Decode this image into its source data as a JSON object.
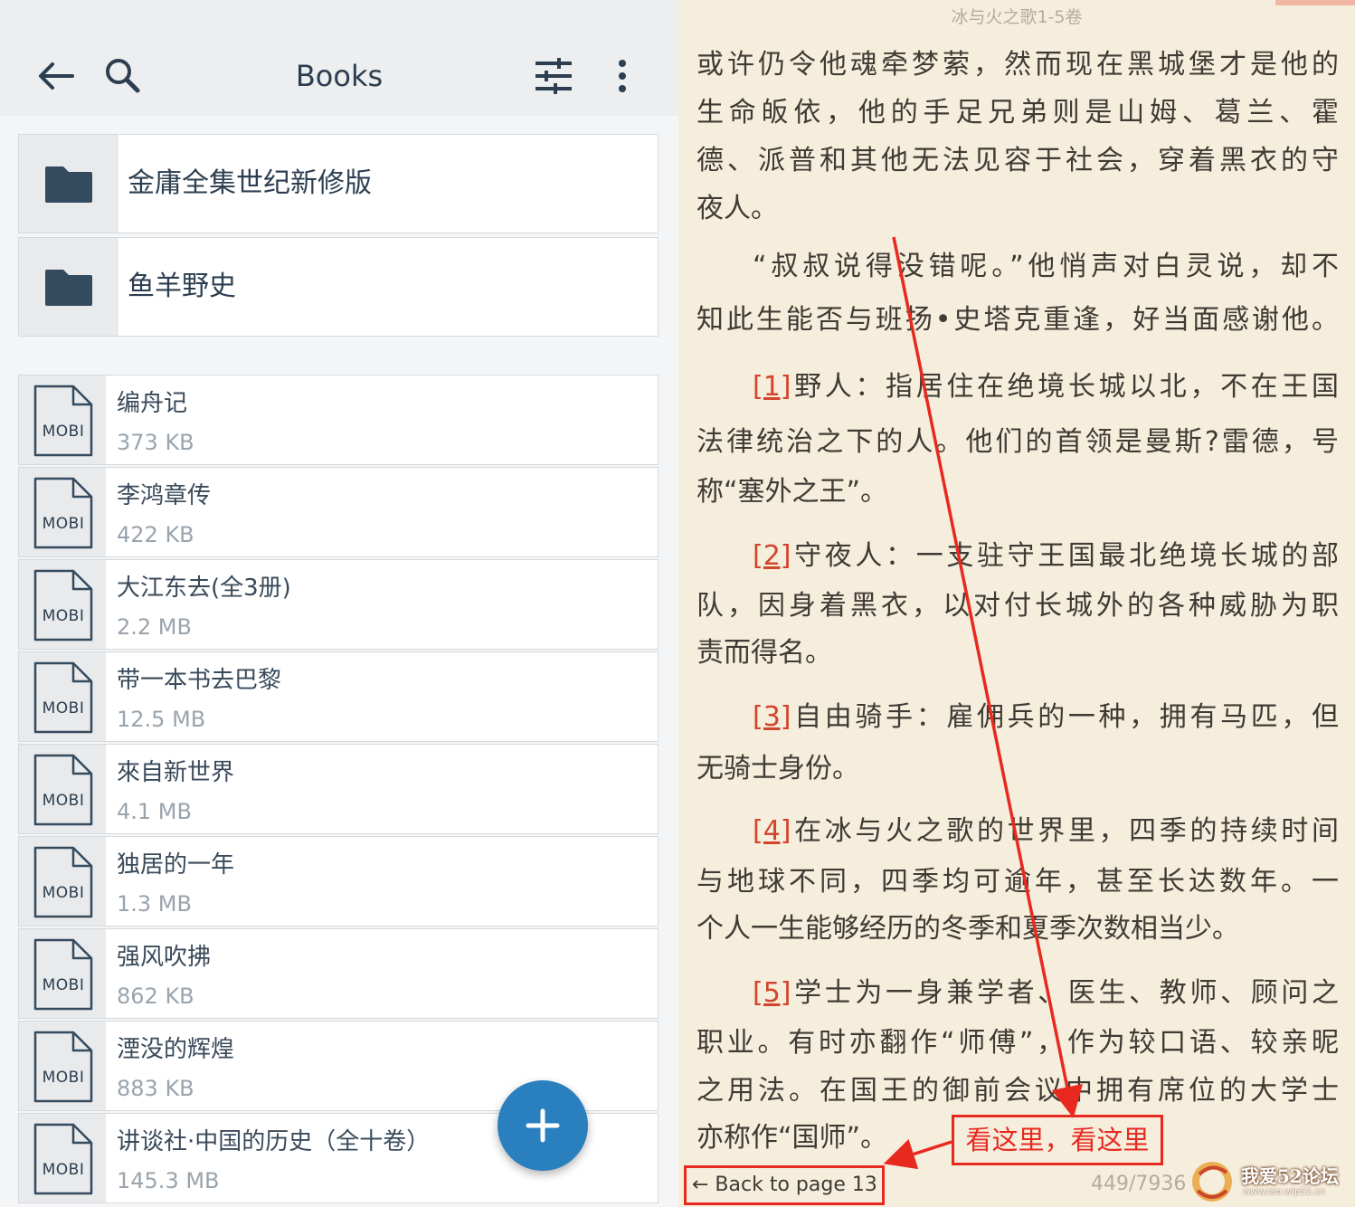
{
  "library": {
    "title": "Books",
    "folders": [
      {
        "name": "金庸全集世纪新修版"
      },
      {
        "name": "鱼羊野史"
      }
    ],
    "books": [
      {
        "format": "MOBI",
        "title": "编舟记",
        "size": "373 KB"
      },
      {
        "format": "MOBI",
        "title": "李鸿章传",
        "size": "422 KB"
      },
      {
        "format": "MOBI",
        "title": "大江东去(全3册)",
        "size": "2.2 MB"
      },
      {
        "format": "MOBI",
        "title": "带一本书去巴黎",
        "size": "12.5 MB"
      },
      {
        "format": "MOBI",
        "title": "來自新世界",
        "size": "4.1 MB"
      },
      {
        "format": "MOBI",
        "title": "独居的一年",
        "size": "1.3 MB"
      },
      {
        "format": "MOBI",
        "title": "强风吹拂",
        "size": "862 KB"
      },
      {
        "format": "MOBI",
        "title": "湮没的辉煌",
        "size": "883 KB"
      },
      {
        "format": "MOBI",
        "title": "讲谈社·中国的历史（全十卷）",
        "size": "145.3 MB"
      }
    ],
    "icons": {
      "back": "arrow-left-icon",
      "search": "search-icon",
      "filter": "sliders-icon",
      "more": "more-vertical-icon",
      "folder": "folder-icon",
      "file": "file-icon",
      "add": "plus-icon"
    },
    "colors": {
      "accent": "#2a7fbf",
      "text": "#2c3e50",
      "muted": "#9aa4ad"
    }
  },
  "reader": {
    "book_title": "冰与火之歌1-5卷",
    "lines": [
      {
        "text": "或许仍令他魂牵梦萦，然而现在黑城堡才是他的"
      },
      {
        "text": "生命皈依，他的手足兄弟则是山姆、葛兰、霍"
      },
      {
        "text": "德、派普和其他无法见容于社会，穿着黑衣的守"
      },
      {
        "text": "夜人。"
      },
      {
        "text": "“叔叔说得没错呢。”他悄声对白灵说，却不"
      },
      {
        "text": "知此生能否与班扬•史塔克重逢，好当面感谢他。"
      },
      {
        "fn": "[1]",
        "text": "野人：指居住在绝境长城以北，不在王国"
      },
      {
        "text": "法律统治之下的人。他们的首领是曼斯?雷德，号"
      },
      {
        "text": "称“塞外之王”。"
      },
      {
        "fn": "[2]",
        "text": "守夜人：一支驻守王国最北绝境长城的部"
      },
      {
        "text": "队，因身着黑衣，以对付长城外的各种威胁为职"
      },
      {
        "text": "责而得名。"
      },
      {
        "fn": "[3]",
        "text": "自由骑手：雇佣兵的一种，拥有马匹，但"
      },
      {
        "text": "无骑士身份。"
      },
      {
        "fn": "[4]",
        "text": "在冰与火之歌的世界里，四季的持续时间"
      },
      {
        "text": "与地球不同，四季均可逾年，甚至长达数年。一"
      },
      {
        "text": "个人一生能够经历的冬季和夏季次数相当少。"
      },
      {
        "fn": "[5]",
        "text": "学士为一身兼学者、医生、教师、顾问之"
      },
      {
        "text": "职业。有时亦翻作“师傅”，作为较口语、较亲昵"
      },
      {
        "text": "之用法。在国王的御前会议中拥有席位的大学士"
      },
      {
        "text": "亦称作“国师”。"
      }
    ],
    "annotation": "看这里，看这里",
    "back_to_page": "← Back to page 13",
    "page_counter": "449/7936",
    "watermark": {
      "text": "我爱52论坛",
      "url": "www.tao.wip52.cn"
    },
    "colors": {
      "background": "#f6eedd",
      "footnote": "#d2442c",
      "annotation": "#e8291f"
    }
  }
}
